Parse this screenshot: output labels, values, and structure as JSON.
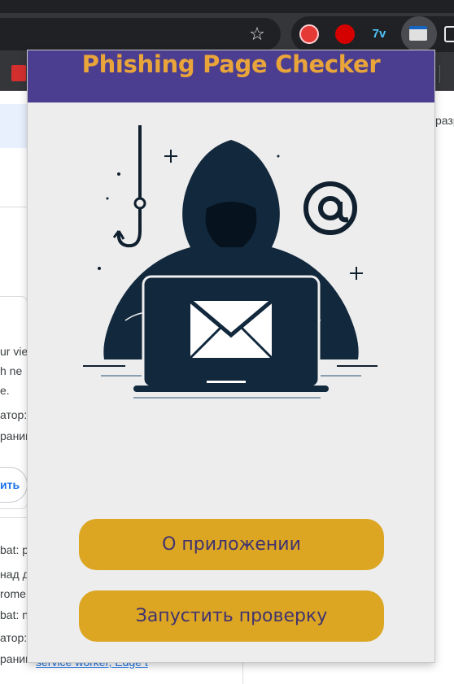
{
  "browser": {
    "bookmark_star_icon": "star-icon",
    "extensions": [
      "red-circle-extension-icon",
      "hand-stop-extension-icon",
      "7v-extension-icon",
      "phishing-checker-extension-icon",
      "puzzle-extensions-icon"
    ],
    "ext_3_label": "7v",
    "bookmark_pdf_icon": "pdf-icon"
  },
  "background_page": {
    "right_text": "разр",
    "lines": [
      "ur vie",
      "h ne",
      "e.",
      "атор:",
      "раниц"
    ],
    "button_text": "ить",
    "lower_lines": [
      "bat: p",
      "над д",
      "rome",
      "bat: n",
      "атор:",
      "раниц"
    ],
    "link_text": "service worker, Edge t"
  },
  "popup": {
    "title": "Phishing Page Checker",
    "hero_icon": "hacker-phishing-illustration",
    "about_button": "О приложении",
    "run_button": "Запустить проверку",
    "colors": {
      "header_bg": "#4b3d8f",
      "title_color": "#e9a53a",
      "button_bg": "#dca623",
      "button_text": "#41336f",
      "body_bg": "#ededed"
    }
  }
}
